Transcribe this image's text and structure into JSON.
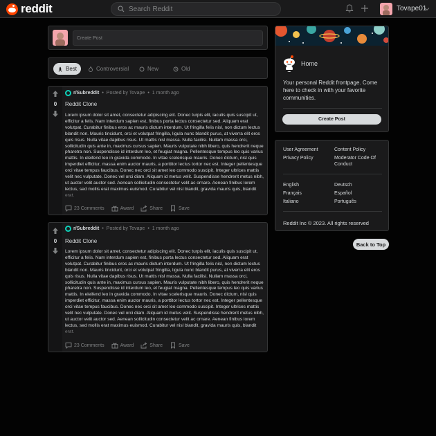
{
  "header": {
    "logo_text": "reddit",
    "search_placeholder": "Search Reddit",
    "username": "Tovape01"
  },
  "create_post": {
    "placeholder": "Create Post"
  },
  "sort": {
    "options": [
      "Best",
      "Controversial",
      "New",
      "Old"
    ],
    "active": "Best"
  },
  "posts": [
    {
      "votes": "0",
      "subreddit": "r/Subreddit",
      "posted_by": "Posted by Tovape",
      "time": "1 month ago",
      "title": "Reddit Clone",
      "body": "Lorem ipsum dolor sit amet, consectetur adipiscing elit. Donec turpis elit, iaculis quis suscipit ut, efficitur a felis. Nam interdum sapien est, finibus porta lectus consectetur sed. Aliquam erat volutpat. Curabitur finibus eros ac mauris dictum interdum. Ut fringilla felis nisl, non dictum lectus blandit non. Mauris tincidunt, orci et volutpat fringilla, ligula nunc blandit purus, at viverra elit eros quis risus. Nulla vitae dapibus risus. Ut mattis nisl massa. Nulla facilisi. Nullam massa orci, sollicitudin quis ante in, maximus cursus sapien. Mauris vulputate nibh libero, quis hendrerit neque pharetra non. Suspendisse id interdum leo, et feugiat magna. Pellentesque tempus leo quis varius mattis. In eleifend leo in gravida commodo. In vitae scelerisque mauris. Donec dictum, nisl quis imperdiet efficitur, massa enim auctor mauris, a porttitor lectus tortor nec est. Integer pellentesque orci vitae tempus faucibus. Donec nec orci sit amet leo commodo suscipit. Integer ultrices mattis velit nec vulputate. Donec vel orci diam. Aliquam id metus velit. Suspendisse hendrerit metus nibh, ut auctor velit auctor sed. Aenean sollicitudin consectetur velit ac ornare. Aenean finibus lorem lectus, sed mollis erat maximus euismod. Curabitur vel nisl blandit, gravida mauris quis, blandit erat.",
      "comments": "23 Comments",
      "award": "Award",
      "share": "Share",
      "save": "Save"
    },
    {
      "votes": "0",
      "subreddit": "r/Subreddit",
      "posted_by": "Posted by Tovape",
      "time": "1 month ago",
      "title": "Reddit Clone",
      "body": "Lorem ipsum dolor sit amet, consectetur adipiscing elit. Donec turpis elit, iaculis quis suscipit ut, efficitur a felis. Nam interdum sapien est, finibus porta lectus consectetur sed. Aliquam erat volutpat. Curabitur finibus eros ac mauris dictum interdum. Ut fringilla felis nisl, non dictum lectus blandit non. Mauris tincidunt, orci et volutpat fringilla, ligula nunc blandit purus, at viverra elit eros quis risus. Nulla vitae dapibus risus. Ut mattis nisl massa. Nulla facilisi. Nullam massa orci, sollicitudin quis ante in, maximus cursus sapien. Mauris vulputate nibh libero, quis hendrerit neque pharetra non. Suspendisse id interdum leo, et feugiat magna. Pellentesque tempus leo quis varius mattis. In eleifend leo in gravida commodo. In vitae scelerisque mauris. Donec dictum, nisl quis imperdiet efficitur, massa enim auctor mauris, a porttitor lectus tortor nec est. Integer pellentesque orci vitae tempus faucibus. Donec nec orci sit amet leo commodo suscipit. Integer ultrices mattis velit nec vulputate. Donec vel orci diam. Aliquam id metus velit. Suspendisse hendrerit metus nibh, ut auctor velit auctor sed. Aenean sollicitudin consectetur velit ac ornare. Aenean finibus lorem lectus, sed mollis erat maximus euismod. Curabitur vel nisl blandit, gravida mauris quis, blandit erat.",
      "comments": "23 Comments",
      "award": "Award",
      "share": "Share",
      "save": "Save"
    }
  ],
  "sidebar": {
    "home_title": "Home",
    "home_description": "Your personal Reddit frontpage. Come here to check in with your favorite communities.",
    "create_post_button": "Create Post",
    "links": {
      "user_agreement": "User Agreement",
      "content_policy": "Content Policy",
      "privacy_policy": "Privacy Policy",
      "moderator_code": "Moderator Code Of Conduct"
    },
    "languages": {
      "english": "English",
      "deutsch": "Deutsch",
      "francais": "Français",
      "espanol": "Español",
      "italiano": "Italiano",
      "portugues": "Português"
    },
    "copyright": "Reddit Inc © 2023. All rights reserved"
  },
  "back_to_top": "Back to Top",
  "colors": {
    "brand": "#ff4500",
    "background": "#030303",
    "card": "#1a1a1b",
    "border": "#343536",
    "text": "#d7dadc",
    "muted": "#818384"
  }
}
